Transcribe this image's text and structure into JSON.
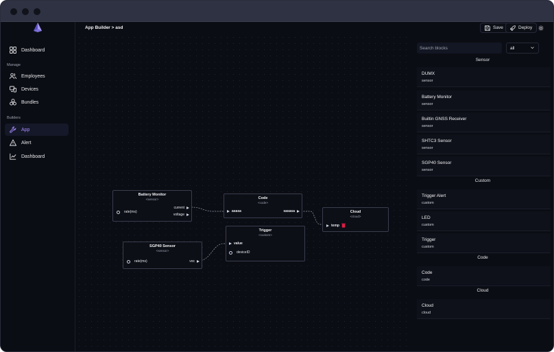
{
  "sidebar": {
    "items": [
      {
        "label": "Dashboard",
        "icon": "dashboard-grid-icon"
      },
      {
        "label": "Employees",
        "icon": "users-icon"
      },
      {
        "label": "Devices",
        "icon": "devices-icon"
      },
      {
        "label": "Bundles",
        "icon": "bundles-icon"
      },
      {
        "label": "App",
        "icon": "wrench-icon",
        "active": true
      },
      {
        "label": "Alert",
        "icon": "alert-triangle-icon"
      },
      {
        "label": "Dashboard",
        "icon": "chart-line-icon"
      }
    ],
    "sections": {
      "manage": "Manage",
      "builders": "Builders"
    }
  },
  "header": {
    "breadcrumb": "App Builder > asd",
    "save_label": "Save",
    "deploy_label": "Deploy"
  },
  "canvas": {
    "nodes": {
      "battery": {
        "title": "Battery Monitor",
        "subtitle": "<sensor>",
        "param": "rate(ms)",
        "out1": "current",
        "out2": "voltage"
      },
      "code": {
        "title": "Code",
        "subtitle": "<code>",
        "in1": "asasa",
        "out1": "sasasa"
      },
      "cloud": {
        "title": "Cloud",
        "subtitle": "<cloud>",
        "in1": "temp"
      },
      "trigger": {
        "title": "Trigger",
        "subtitle": "<custom>",
        "in1": "value",
        "param": "deviceID"
      },
      "sgp40": {
        "title": "SGP40 Sensor",
        "subtitle": "<sensor>",
        "param": "rate(ms)",
        "out1": "voc"
      }
    }
  },
  "panel": {
    "search_placeholder": "Search blocks",
    "filter_value": "all",
    "groups": [
      {
        "title": "Sensor",
        "blocks": [
          {
            "name": "DUMX",
            "type": "sensor"
          },
          {
            "name": "Battery Monitor",
            "type": "sensor"
          },
          {
            "name": "Builtin GNSS Receiver",
            "type": "sensor"
          },
          {
            "name": "SHTC3 Sensor",
            "type": "sensor"
          },
          {
            "name": "SGP40 Sensor",
            "type": "sensor"
          }
        ]
      },
      {
        "title": "Custom",
        "blocks": [
          {
            "name": "Trigger Alert",
            "type": "custom"
          },
          {
            "name": "LED",
            "type": "custom"
          },
          {
            "name": "Trigger",
            "type": "custom"
          }
        ]
      },
      {
        "title": "Code",
        "blocks": [
          {
            "name": "Code",
            "type": "code"
          }
        ]
      },
      {
        "title": "Cloud",
        "blocks": [
          {
            "name": "Cloud",
            "type": "cloud"
          }
        ]
      }
    ]
  },
  "colors": {
    "accent": "#a78bfa",
    "background": "#0b0d14",
    "titlebar": "#2f3242",
    "delete": "#e11d48"
  }
}
